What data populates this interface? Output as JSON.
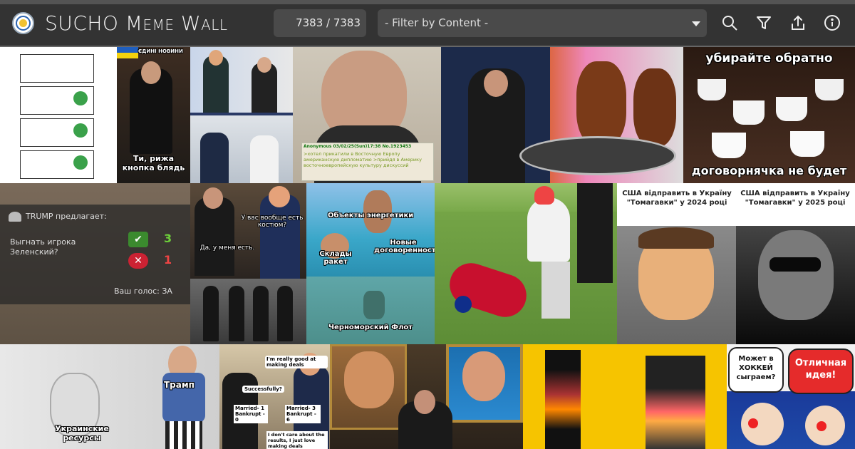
{
  "app": {
    "title": "SUCHO Meme Wall"
  },
  "counter": {
    "text": "7383 / 7383"
  },
  "filter": {
    "selected": "- Filter by Content -"
  },
  "toolbar": [
    {
      "name": "search-icon"
    },
    {
      "name": "filter-icon"
    },
    {
      "name": "upload-icon"
    },
    {
      "name": "info-icon"
    }
  ],
  "tiles": {
    "t2": {
      "badge": "ЄДИНІ НОВИНИ",
      "caption": "Ти, рижа кнопка блядь"
    },
    "t4": {
      "header": "Anonymous 03/02/25(Sun)17:38 No.1923453",
      "body": ">хотел прикатили в Восточную Европу американскую дипломатию >прийдя в Америку восточноевропейскую культуру дискуссий"
    },
    "t6": {
      "top": "убирайте обратно",
      "bottom": "договорнячка не будет"
    },
    "t7": {
      "title": "TRUMP предлагает:",
      "question": "Выгнать игрока Зеленский?",
      "yes": "3",
      "no": "1",
      "vote": "Ваш голос: ЗА"
    },
    "t8": {
      "q": "У вас вообще есть костюм?",
      "a": "Да, у меня есть."
    },
    "t9": {
      "a": "Объекты энергетики",
      "b": "Новые договоренности",
      "c": "Склады ракет"
    },
    "t11": {
      "caption": "Черноморский Флот"
    },
    "t13": {
      "left": "США відправить в Україну \"Томагавки\" у 2024 році",
      "right": "США відправить в Україну \"Томагавки\" у 2025 році"
    },
    "t14": {
      "a": "Трамп",
      "b": "Украинские ресурсы"
    },
    "t15": {
      "b1": "I'm really good at making deals",
      "b2": "Successfully?",
      "b3": "Married- 1 Bankrupt - 0",
      "b4": "Married- 3 Bankrupt - 6",
      "b5": "I don't care about the results, I just love making deals"
    },
    "t17": {
      "q": "Может в ХОККЕЙ сыграем?",
      "a": "Отличная идея!"
    }
  },
  "colors": {
    "topbar": "#333333",
    "accent_yellow": "#f6c400",
    "red_bubble": "#e52b2b"
  }
}
